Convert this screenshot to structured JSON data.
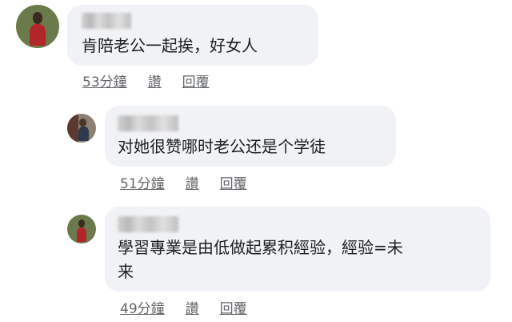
{
  "comments": [
    {
      "text": "肯陪老公一起挨，好女人",
      "time": "53分鐘",
      "like": "讚",
      "reply": "回覆"
    },
    {
      "text": "对她很赞哪时老公还是个学徒",
      "time": "51分鐘",
      "like": "讚",
      "reply": "回覆"
    },
    {
      "text": "學習專業是由低做起累积經验，經验=未\n来",
      "time": "49分鐘",
      "like": "讚",
      "reply": "回覆"
    }
  ]
}
